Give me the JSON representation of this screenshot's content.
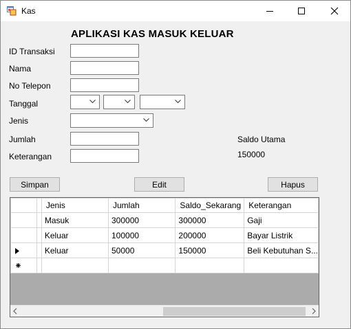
{
  "window": {
    "title": "Kas",
    "icon": "app-window-icon"
  },
  "heading": "APLIKASI KAS MASUK KELUAR",
  "form": {
    "id_label": "ID Transaksi",
    "nama_label": "Nama",
    "telepon_label": "No Telepon",
    "tanggal_label": "Tanggal",
    "jenis_label": "Jenis",
    "jumlah_label": "Jumlah",
    "keterangan_label": "Keterangan"
  },
  "saldo": {
    "label": "Saldo Utama",
    "value": "150000"
  },
  "buttons": {
    "simpan": "Simpan",
    "edit": "Edit",
    "hapus": "Hapus"
  },
  "table": {
    "columns": [
      "Jenis",
      "Jumlah",
      "Saldo_Sekarang",
      "Keterangan"
    ],
    "rows": [
      {
        "jenis": "Masuk",
        "jumlah": "300000",
        "saldo": "300000",
        "keterangan": "Gaji"
      },
      {
        "jenis": "Keluar",
        "jumlah": "100000",
        "saldo": "200000",
        "keterangan": "Bayar Listrik"
      },
      {
        "jenis": "Keluar",
        "jumlah": "50000",
        "saldo": "150000",
        "keterangan": "Beli Kebutuhan S..."
      }
    ],
    "current_row_marker": "row-pointer-icon",
    "new_row_marker": "new-row-icon"
  }
}
